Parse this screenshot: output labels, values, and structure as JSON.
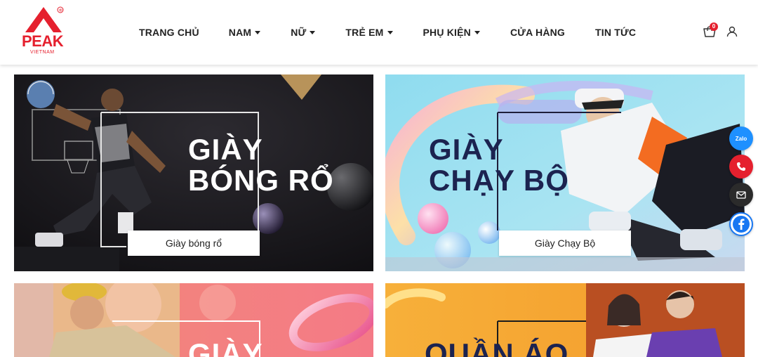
{
  "brand": {
    "name": "PEAK",
    "sub": "VIETNAM",
    "reg": "®",
    "color": "#e5202e"
  },
  "nav": {
    "items": [
      {
        "label": "TRANG CHỦ",
        "dropdown": false
      },
      {
        "label": "NAM",
        "dropdown": true
      },
      {
        "label": "NỮ",
        "dropdown": true
      },
      {
        "label": "TRẺ EM",
        "dropdown": true
      },
      {
        "label": "PHỤ KIỆN",
        "dropdown": true
      },
      {
        "label": "CỬA HÀNG",
        "dropdown": false
      },
      {
        "label": "TIN TỨC",
        "dropdown": false
      }
    ]
  },
  "header": {
    "cart_count": "0",
    "cart_icon": "cart-icon",
    "user_icon": "user-icon"
  },
  "banners": [
    {
      "title_line1": "GIÀY",
      "title_line2": "BÓNG RỔ",
      "button": "Giày bóng rổ"
    },
    {
      "title_line1": "GIÀY",
      "title_line2": "CHẠY BỘ",
      "button": "Giày Chạy Bộ"
    },
    {
      "title_line1": "GIÀY",
      "title_line2": "",
      "button": ""
    },
    {
      "title_line1": "QUẦN ÁO",
      "title_line2": "",
      "button": ""
    }
  ],
  "contact": {
    "zalo_label": "Zalo",
    "zalo_color": "#1e90ff",
    "phone_color": "#e5202e",
    "email_color": "#2b2b2b",
    "facebook_color": "#1877f2"
  }
}
